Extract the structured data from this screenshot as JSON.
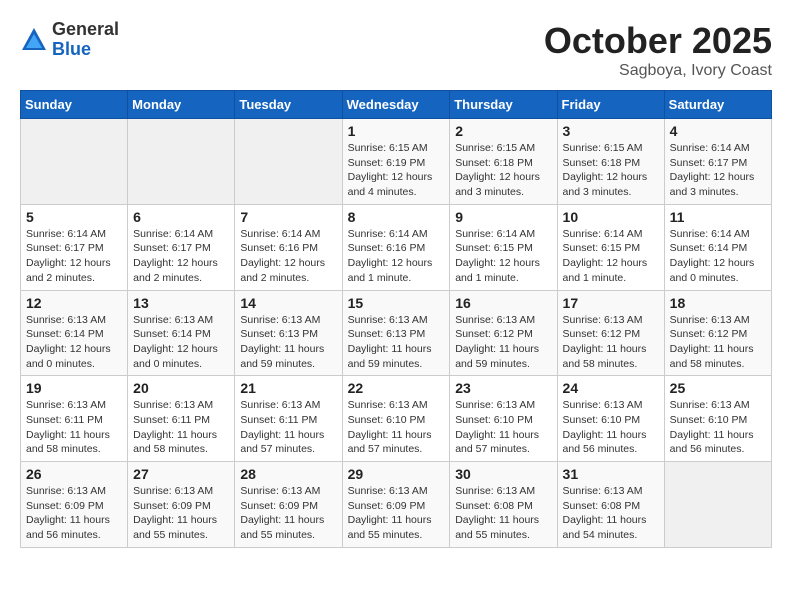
{
  "logo": {
    "general": "General",
    "blue": "Blue"
  },
  "title": "October 2025",
  "subtitle": "Sagboya, Ivory Coast",
  "days_of_week": [
    "Sunday",
    "Monday",
    "Tuesday",
    "Wednesday",
    "Thursday",
    "Friday",
    "Saturday"
  ],
  "weeks": [
    [
      {
        "day": "",
        "info": ""
      },
      {
        "day": "",
        "info": ""
      },
      {
        "day": "",
        "info": ""
      },
      {
        "day": "1",
        "info": "Sunrise: 6:15 AM\nSunset: 6:19 PM\nDaylight: 12 hours\nand 4 minutes."
      },
      {
        "day": "2",
        "info": "Sunrise: 6:15 AM\nSunset: 6:18 PM\nDaylight: 12 hours\nand 3 minutes."
      },
      {
        "day": "3",
        "info": "Sunrise: 6:15 AM\nSunset: 6:18 PM\nDaylight: 12 hours\nand 3 minutes."
      },
      {
        "day": "4",
        "info": "Sunrise: 6:14 AM\nSunset: 6:17 PM\nDaylight: 12 hours\nand 3 minutes."
      }
    ],
    [
      {
        "day": "5",
        "info": "Sunrise: 6:14 AM\nSunset: 6:17 PM\nDaylight: 12 hours\nand 2 minutes."
      },
      {
        "day": "6",
        "info": "Sunrise: 6:14 AM\nSunset: 6:17 PM\nDaylight: 12 hours\nand 2 minutes."
      },
      {
        "day": "7",
        "info": "Sunrise: 6:14 AM\nSunset: 6:16 PM\nDaylight: 12 hours\nand 2 minutes."
      },
      {
        "day": "8",
        "info": "Sunrise: 6:14 AM\nSunset: 6:16 PM\nDaylight: 12 hours\nand 1 minute."
      },
      {
        "day": "9",
        "info": "Sunrise: 6:14 AM\nSunset: 6:15 PM\nDaylight: 12 hours\nand 1 minute."
      },
      {
        "day": "10",
        "info": "Sunrise: 6:14 AM\nSunset: 6:15 PM\nDaylight: 12 hours\nand 1 minute."
      },
      {
        "day": "11",
        "info": "Sunrise: 6:14 AM\nSunset: 6:14 PM\nDaylight: 12 hours\nand 0 minutes."
      }
    ],
    [
      {
        "day": "12",
        "info": "Sunrise: 6:13 AM\nSunset: 6:14 PM\nDaylight: 12 hours\nand 0 minutes."
      },
      {
        "day": "13",
        "info": "Sunrise: 6:13 AM\nSunset: 6:14 PM\nDaylight: 12 hours\nand 0 minutes."
      },
      {
        "day": "14",
        "info": "Sunrise: 6:13 AM\nSunset: 6:13 PM\nDaylight: 11 hours\nand 59 minutes."
      },
      {
        "day": "15",
        "info": "Sunrise: 6:13 AM\nSunset: 6:13 PM\nDaylight: 11 hours\nand 59 minutes."
      },
      {
        "day": "16",
        "info": "Sunrise: 6:13 AM\nSunset: 6:12 PM\nDaylight: 11 hours\nand 59 minutes."
      },
      {
        "day": "17",
        "info": "Sunrise: 6:13 AM\nSunset: 6:12 PM\nDaylight: 11 hours\nand 58 minutes."
      },
      {
        "day": "18",
        "info": "Sunrise: 6:13 AM\nSunset: 6:12 PM\nDaylight: 11 hours\nand 58 minutes."
      }
    ],
    [
      {
        "day": "19",
        "info": "Sunrise: 6:13 AM\nSunset: 6:11 PM\nDaylight: 11 hours\nand 58 minutes."
      },
      {
        "day": "20",
        "info": "Sunrise: 6:13 AM\nSunset: 6:11 PM\nDaylight: 11 hours\nand 58 minutes."
      },
      {
        "day": "21",
        "info": "Sunrise: 6:13 AM\nSunset: 6:11 PM\nDaylight: 11 hours\nand 57 minutes."
      },
      {
        "day": "22",
        "info": "Sunrise: 6:13 AM\nSunset: 6:10 PM\nDaylight: 11 hours\nand 57 minutes."
      },
      {
        "day": "23",
        "info": "Sunrise: 6:13 AM\nSunset: 6:10 PM\nDaylight: 11 hours\nand 57 minutes."
      },
      {
        "day": "24",
        "info": "Sunrise: 6:13 AM\nSunset: 6:10 PM\nDaylight: 11 hours\nand 56 minutes."
      },
      {
        "day": "25",
        "info": "Sunrise: 6:13 AM\nSunset: 6:10 PM\nDaylight: 11 hours\nand 56 minutes."
      }
    ],
    [
      {
        "day": "26",
        "info": "Sunrise: 6:13 AM\nSunset: 6:09 PM\nDaylight: 11 hours\nand 56 minutes."
      },
      {
        "day": "27",
        "info": "Sunrise: 6:13 AM\nSunset: 6:09 PM\nDaylight: 11 hours\nand 55 minutes."
      },
      {
        "day": "28",
        "info": "Sunrise: 6:13 AM\nSunset: 6:09 PM\nDaylight: 11 hours\nand 55 minutes."
      },
      {
        "day": "29",
        "info": "Sunrise: 6:13 AM\nSunset: 6:09 PM\nDaylight: 11 hours\nand 55 minutes."
      },
      {
        "day": "30",
        "info": "Sunrise: 6:13 AM\nSunset: 6:08 PM\nDaylight: 11 hours\nand 55 minutes."
      },
      {
        "day": "31",
        "info": "Sunrise: 6:13 AM\nSunset: 6:08 PM\nDaylight: 11 hours\nand 54 minutes."
      },
      {
        "day": "",
        "info": ""
      }
    ]
  ]
}
